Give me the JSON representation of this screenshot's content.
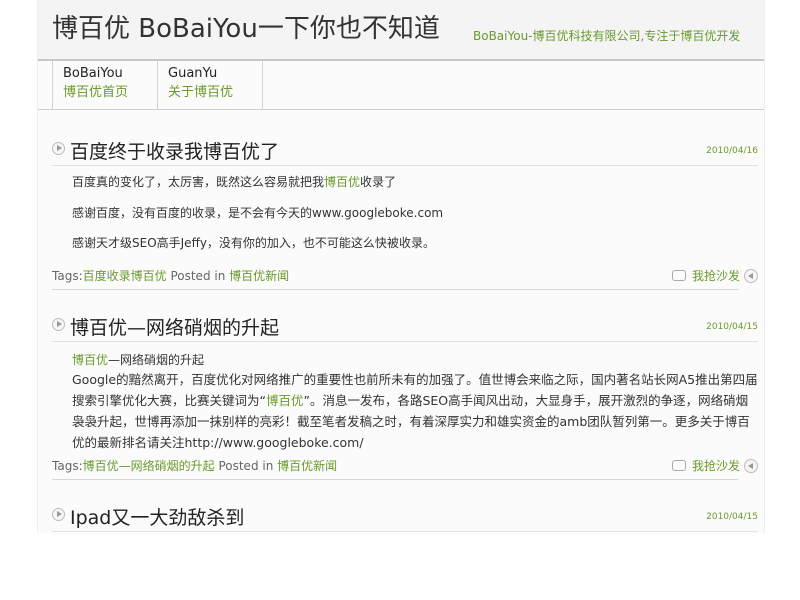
{
  "header": {
    "site_title": "博百优 BoBaiYou一下你也不知道",
    "tagline": "BoBaiYou-博百优科技有限公司,专注于博百优开发"
  },
  "nav": [
    {
      "en": "BoBaiYou",
      "cn": "博百优首页"
    },
    {
      "en": "GuanYu",
      "cn": "关于博百优"
    }
  ],
  "posts": [
    {
      "title": "百度终于收录我博百优了",
      "date": "2010/04/16",
      "body": {
        "p1_pre": "百度真的变化了，太厉害，既然这么容易就把我",
        "p1_link": "博百优",
        "p1_post": "收录了",
        "p2": "感谢百度，没有百度的收录，是不会有今天的www.googleboke.com",
        "p3": "感谢天才级SEO高手Jeffy，没有你的加入，也不可能这么快被收录。"
      },
      "tags_label": "Tags:",
      "tags": "百度收录博百优",
      "posted_in": "Posted in",
      "category": "博百优新闻",
      "comment": "我抢沙发"
    },
    {
      "title": "博百优—网络硝烟的升起",
      "date": "2010/04/15",
      "body": {
        "l1_link": "博百优",
        "l1_post": "—网络硝烟的升起",
        "para_pre": "Google的黯然离开，百度优化对网络推广的重要性也前所未有的加强了。值世博会来临之际，国内著名站长网A5推出第四届搜索引擎优化大赛，比赛关键词为“",
        "para_link": "博百优",
        "para_post": "”。消息一发布，各路SEO高手闻风出动，大显身手，展开激烈的争逐，网络硝烟袅袅升起，世博再添加一抹别样的亮彩！截至笔者发稿之时，有着深厚实力和雄实资金的amb团队暂列第一。更多关于博百优的最新排名请关注http://www.googleboke.com/"
      },
      "tags_label": "Tags:",
      "tags": "博百优—网络硝烟的升起",
      "posted_in": "Posted in",
      "category": "博百优新闻",
      "comment": "我抢沙发"
    },
    {
      "title": "Ipad又一大劲敌杀到",
      "date": "2010/04/15"
    }
  ]
}
